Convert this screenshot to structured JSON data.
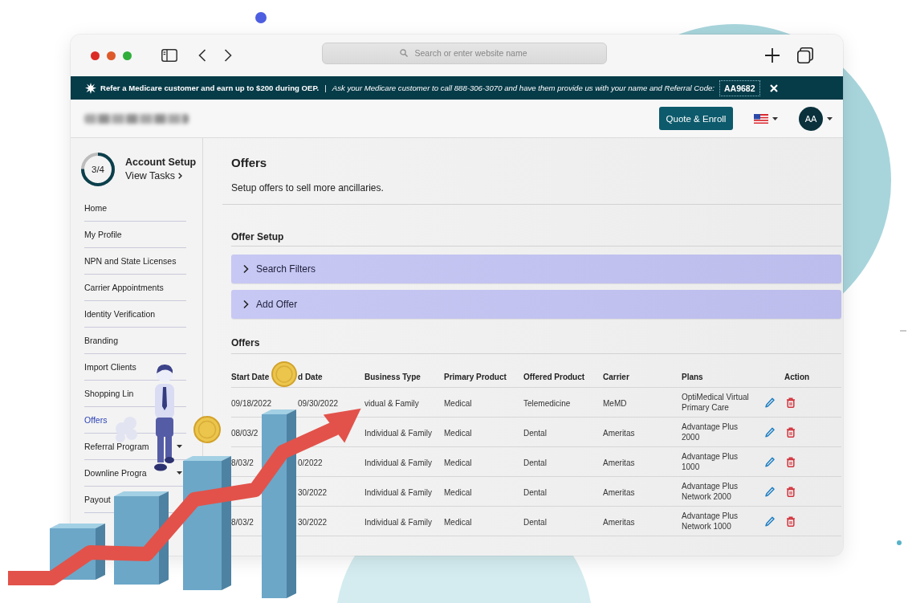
{
  "browser": {
    "address_bar": {
      "placeholder": "Search or enter website name"
    }
  },
  "banner": {
    "headline": "Refer a Medicare customer and earn up to $200 during OEP.",
    "separator": "|",
    "message": "Ask your Medicare customer to call 888-306-3070 and have them provide us with your name and Referral Code:",
    "referral_code": "AA9682"
  },
  "header": {
    "button": "Quote & Enroll",
    "avatar": "AA"
  },
  "sidebar": {
    "account_setup": {
      "progress": "3/4",
      "level": 0.75,
      "title": "Account Setup",
      "link": "View Tasks"
    },
    "items": [
      {
        "label": "Home",
        "kind": "link",
        "selected": false
      },
      {
        "label": "My Profile",
        "kind": "link",
        "selected": false
      },
      {
        "label": "NPN and State Licenses",
        "kind": "link",
        "selected": false
      },
      {
        "label": "Carrier Appointments",
        "kind": "link",
        "selected": false
      },
      {
        "label": "Identity Verification",
        "kind": "link",
        "selected": false
      },
      {
        "label": "Branding",
        "kind": "link",
        "selected": false
      },
      {
        "label": "Import Clients",
        "kind": "link",
        "selected": false
      },
      {
        "label": "Shopping Lin",
        "kind": "link",
        "selected": false
      },
      {
        "label": "Offers",
        "kind": "link",
        "selected": true
      },
      {
        "label": "Referral Program",
        "kind": "group",
        "selected": false
      },
      {
        "label": "Downline Progra",
        "kind": "group",
        "selected": false
      },
      {
        "label": "Payout",
        "kind": "link",
        "selected": false
      }
    ]
  },
  "page": {
    "title": "Offers",
    "subtitle": "Setup offers to sell more ancillaries.",
    "setup_title": "Offer Setup",
    "panels": [
      {
        "label": "Search Filters",
        "expanded": false
      },
      {
        "label": "Add Offer",
        "expanded": false
      }
    ],
    "list_title": "Offers",
    "table": {
      "columns": [
        "Start Date",
        "d Date",
        "Business Type",
        "Primary Product",
        "Offered Product",
        "Carrier",
        "Plans",
        "Action"
      ],
      "rows": [
        {
          "cells": [
            "09/18/2022",
            "09/30/2022",
            "vidual & Family",
            "Medical",
            "Telemedicine",
            "MeMD",
            "OptiMedical Virtual Primary Care"
          ]
        },
        {
          "cells": [
            "08/03/2",
            null,
            "Individual & Family",
            "Medical",
            "Dental",
            "Ameritas",
            "Advantage Plus 2000"
          ]
        },
        {
          "cells": [
            "8/03/2",
            "0/2022",
            "Individual & Family",
            "Medical",
            "Dental",
            "Ameritas",
            "Advantage Plus 1000"
          ]
        },
        {
          "cells": [
            null,
            "30/2022",
            "Individual & Family",
            "Medical",
            "Dental",
            "Ameritas",
            "Advantage Plus Network 2000"
          ]
        },
        {
          "cells": [
            "8/03/2",
            "30/2022",
            "Individual & Family",
            "Medical",
            "Dental",
            "Ameritas",
            "Advantage Plus Network 1000"
          ]
        }
      ]
    }
  }
}
